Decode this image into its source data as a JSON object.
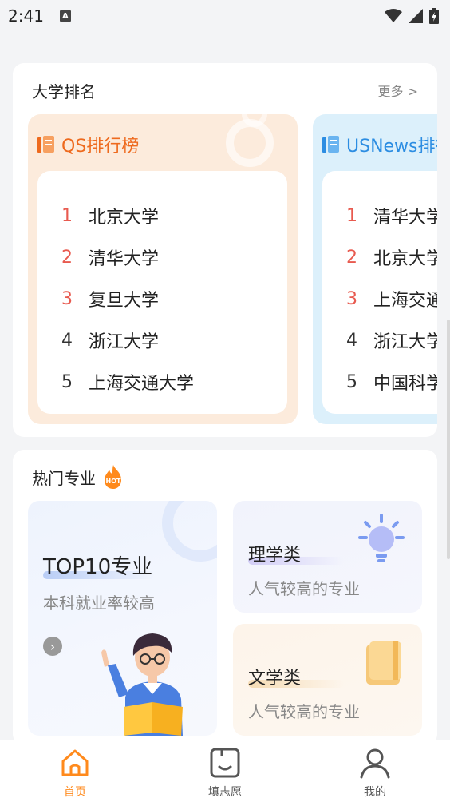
{
  "status_bar": {
    "time": "2:41"
  },
  "ranking": {
    "title": "大学排名",
    "more": "更多 >",
    "boards": [
      {
        "name": "QS排行榜",
        "items": [
          {
            "rank": "1",
            "name": "北京大学"
          },
          {
            "rank": "2",
            "name": "清华大学"
          },
          {
            "rank": "3",
            "name": "复旦大学"
          },
          {
            "rank": "4",
            "name": "浙江大学"
          },
          {
            "rank": "5",
            "name": "上海交通大学"
          }
        ]
      },
      {
        "name": "USNews排行榜",
        "items": [
          {
            "rank": "1",
            "name": "清华大学"
          },
          {
            "rank": "2",
            "name": "北京大学"
          },
          {
            "rank": "3",
            "name": "上海交通大学"
          },
          {
            "rank": "4",
            "name": "浙江大学"
          },
          {
            "rank": "5",
            "name": "中国科学技术大学"
          }
        ]
      }
    ]
  },
  "hot_majors": {
    "title": "热门专业",
    "badge": "HOT",
    "tiles": [
      {
        "heading": "TOP10专业",
        "sub": "本科就业率较高"
      },
      {
        "heading": "理学类",
        "sub": "人气较高的专业"
      },
      {
        "heading": "文学类",
        "sub": "人气较高的专业"
      }
    ]
  },
  "nav": {
    "items": [
      {
        "label": "首页",
        "icon": "home-icon"
      },
      {
        "label": "填志愿",
        "icon": "form-icon"
      },
      {
        "label": "我的",
        "icon": "user-icon"
      }
    ]
  },
  "colors": {
    "accent": "#ff8a1c",
    "qs": "#ee6a1e",
    "usnews": "#2c8de2",
    "rank_top": "#e85a4f"
  }
}
